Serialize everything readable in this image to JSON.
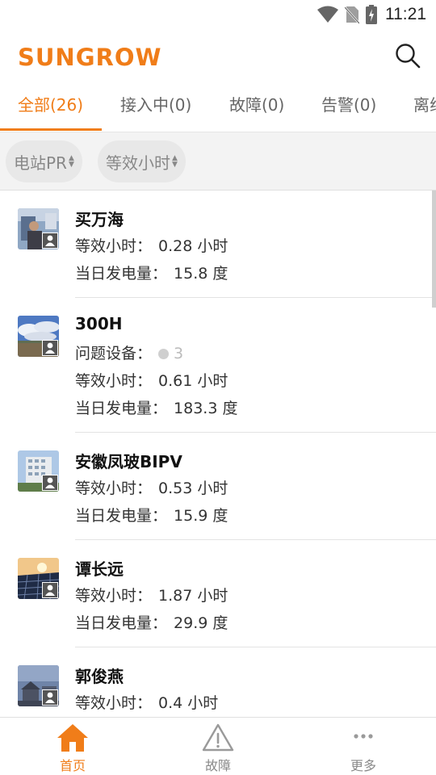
{
  "status_bar": {
    "time": "11:21",
    "icons": [
      "wifi-icon",
      "no-sim-icon",
      "battery-charging-icon"
    ]
  },
  "header": {
    "logo_text": "SUNGROW",
    "search_icon": "search-icon"
  },
  "tabs": [
    {
      "label": "全部(26)",
      "active": true
    },
    {
      "label": "接入中(0)",
      "active": false
    },
    {
      "label": "故障(0)",
      "active": false
    },
    {
      "label": "告警(0)",
      "active": false
    },
    {
      "label": "离线",
      "active": false
    }
  ],
  "filters": [
    {
      "label": "电站PR"
    },
    {
      "label": "等效小时"
    }
  ],
  "stations": [
    {
      "name": "买万海",
      "hours_label": "等效小时：",
      "hours_value": "0.28 小时",
      "energy_label": "当日发电量：",
      "energy_value": "15.8 度"
    },
    {
      "name": "300H",
      "issue_label": "问题设备：",
      "issue_count": "3",
      "hours_label": "等效小时：",
      "hours_value": "0.61 小时",
      "energy_label": "当日发电量：",
      "energy_value": "183.3 度"
    },
    {
      "name": "安徽凤玻BIPV",
      "hours_label": "等效小时：",
      "hours_value": "0.53 小时",
      "energy_label": "当日发电量：",
      "energy_value": "15.9 度"
    },
    {
      "name": "谭长远",
      "hours_label": "等效小时：",
      "hours_value": "1.87 小时",
      "energy_label": "当日发电量：",
      "energy_value": "29.9 度"
    },
    {
      "name": "郭俊燕",
      "hours_label": "等效小时：",
      "hours_value": "0.4 小时"
    }
  ],
  "bottom_nav": [
    {
      "label": "首页",
      "icon": "home-icon",
      "active": true
    },
    {
      "label": "故障",
      "icon": "warning-icon",
      "active": false
    },
    {
      "label": "更多",
      "icon": "more-icon",
      "active": false
    }
  ],
  "colors": {
    "accent": "#f07d19",
    "text": "#333333",
    "muted": "#8a8a8a"
  }
}
